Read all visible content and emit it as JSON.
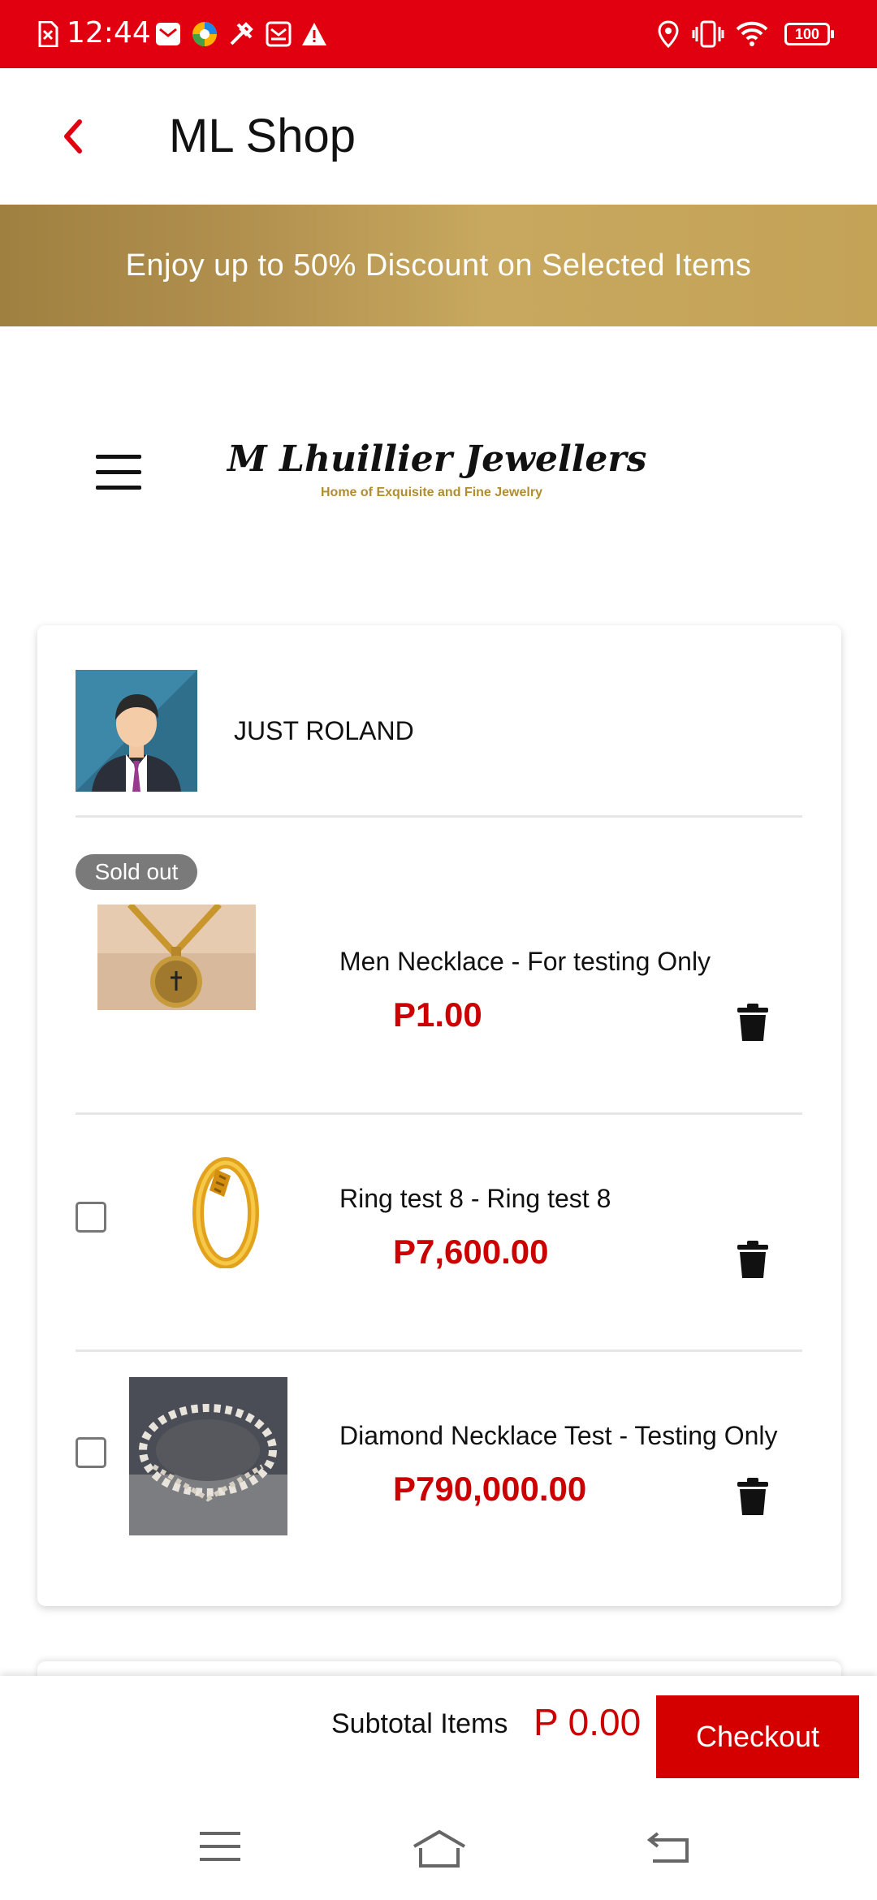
{
  "status_bar": {
    "time": "12:44",
    "battery": "100",
    "background": "#e1000f",
    "icons": [
      "no-sim-icon",
      "mail-icon",
      "browser-icon",
      "tools-icon",
      "inbox-icon",
      "warning-icon",
      "location-icon",
      "vibrate-icon",
      "wifi-icon",
      "battery-icon"
    ]
  },
  "header": {
    "title": "ML Shop",
    "back_icon": "chevron-left-icon",
    "accent": "#e1000f"
  },
  "banner": {
    "text": "Enjoy up to 50% Discount on Selected Items"
  },
  "brand": {
    "logo_text": "M Lhuillier Jewellers",
    "tagline": "Home of Exquisite and Fine Jewelry"
  },
  "cart": {
    "seller_name": "JUST ROLAND",
    "items": [
      {
        "badge": "Sold out",
        "name": "Men Necklace - For testing Only",
        "price": "P1.00",
        "has_checkbox": false
      },
      {
        "name": "Ring test 8 - Ring test 8",
        "price": "P7,600.00",
        "has_checkbox": true
      },
      {
        "name": "Diamond Necklace Test - Testing Only",
        "price": "P790,000.00",
        "has_checkbox": true
      }
    ]
  },
  "checkout": {
    "subtotal_label": "Subtotal Items",
    "subtotal_value": "P 0.00",
    "button_label": "Checkout"
  },
  "system_nav": [
    "menu-icon",
    "home-icon",
    "back-icon"
  ]
}
